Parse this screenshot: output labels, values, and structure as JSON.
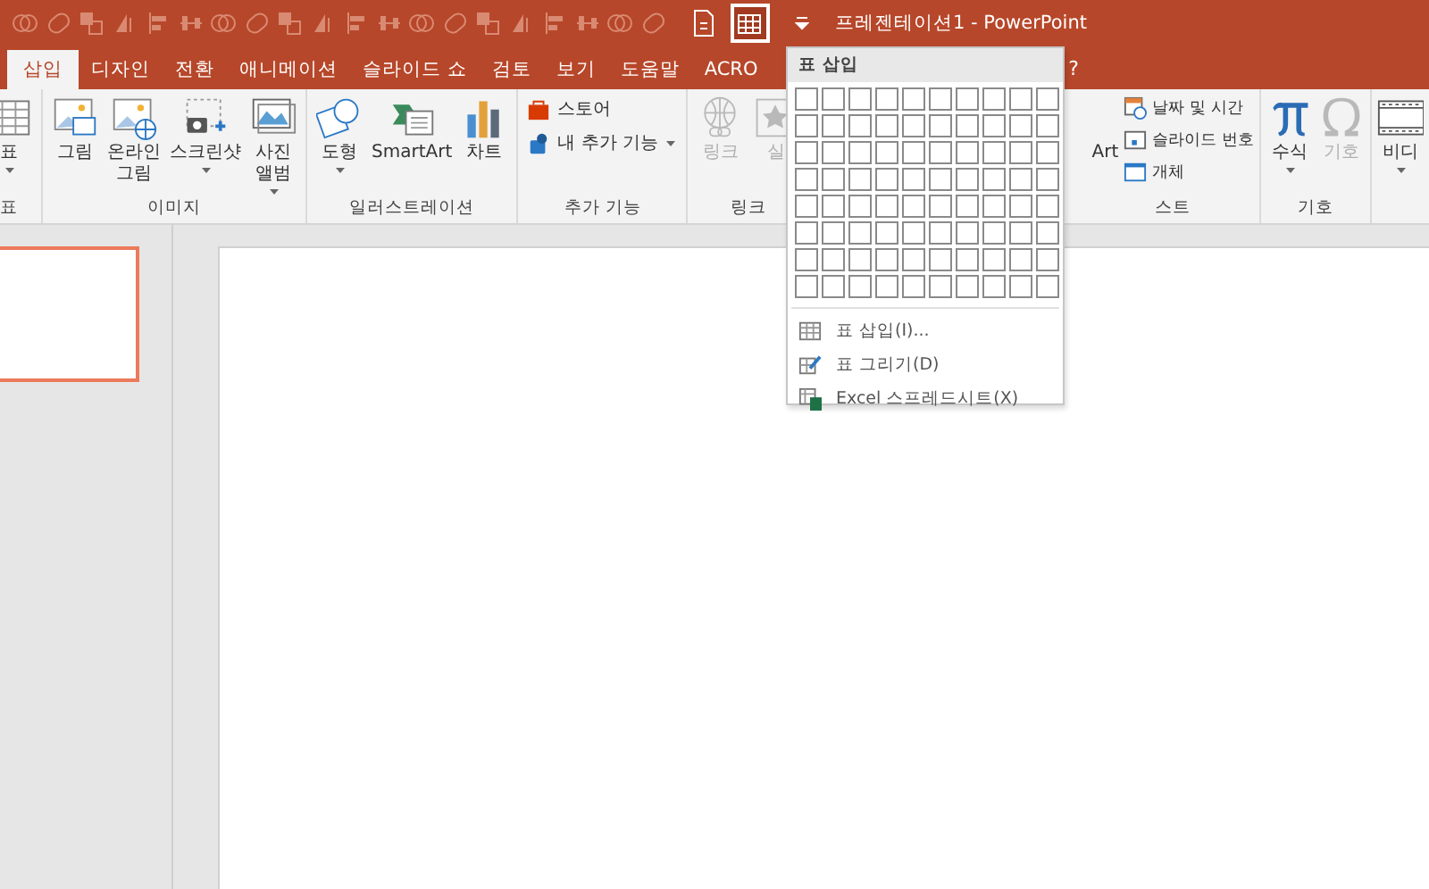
{
  "title_bar": {
    "table_button_selected": true,
    "title": "프레젠테이션1  -  PowerPoint"
  },
  "tabs": [
    {
      "label": "삽입",
      "selected": true
    },
    {
      "label": "디자인",
      "selected": false
    },
    {
      "label": "전환",
      "selected": false
    },
    {
      "label": "애니메이션",
      "selected": false
    },
    {
      "label": "슬라이드 쇼",
      "selected": false
    },
    {
      "label": "검토",
      "selected": false
    },
    {
      "label": "보기",
      "selected": false
    },
    {
      "label": "도움말",
      "selected": false
    },
    {
      "label": "ACRO",
      "selected": false
    }
  ],
  "tell_me": "?",
  "ribbon": [
    {
      "label": "표",
      "items": [
        {
          "kind": "large",
          "label": "표",
          "caret": true,
          "disabled": false
        }
      ]
    },
    {
      "label": "이미지",
      "items": [
        {
          "kind": "large",
          "label": "그림",
          "caret": false,
          "disabled": false
        },
        {
          "kind": "large",
          "label": "온라인 그림",
          "caret": false,
          "disabled": false
        },
        {
          "kind": "large",
          "label": "스크린샷",
          "caret": true,
          "disabled": false
        },
        {
          "kind": "large",
          "label": "사진 앨범",
          "caret": true,
          "disabled": false
        }
      ]
    },
    {
      "label": "일러스트레이션",
      "items": [
        {
          "kind": "large",
          "label": "도형",
          "caret": true,
          "disabled": false
        },
        {
          "kind": "large",
          "label": "SmartArt",
          "caret": false,
          "disabled": false
        },
        {
          "kind": "large",
          "label": "차트",
          "caret": false,
          "disabled": false
        }
      ]
    },
    {
      "label": "추가 기능",
      "items": [
        {
          "kind": "small",
          "label": "스토어",
          "caret": false,
          "disabled": false
        },
        {
          "kind": "small",
          "label": "내 추가 기능",
          "caret": true,
          "disabled": false
        }
      ]
    },
    {
      "label": "링크",
      "items": [
        {
          "kind": "large",
          "label": "링크",
          "caret": false,
          "disabled": true
        },
        {
          "kind": "large",
          "label": "실",
          "caret": false,
          "disabled": true
        }
      ]
    },
    {
      "label": "스트",
      "items": [
        {
          "kind": "large",
          "label": "Art",
          "caret": false,
          "disabled": false
        },
        {
          "kind": "small",
          "label": "날짜 및 시간",
          "caret": false,
          "disabled": false
        },
        {
          "kind": "small",
          "label": "슬라이드 번호",
          "caret": false,
          "disabled": false
        },
        {
          "kind": "small",
          "label": "개체",
          "caret": false,
          "disabled": false
        }
      ]
    },
    {
      "label": "기호",
      "items": [
        {
          "kind": "large",
          "label": "수식",
          "caret": true,
          "disabled": false
        },
        {
          "kind": "large",
          "label": "기호",
          "caret": false,
          "disabled": true
        }
      ]
    },
    {
      "items": [
        {
          "kind": "large",
          "label": "비디",
          "caret": true,
          "disabled": false
        }
      ]
    }
  ],
  "table_menu": {
    "header": "표 삽입",
    "items": [
      {
        "label": "표 삽입(I)..."
      },
      {
        "label": "표 그리기(D)"
      },
      {
        "label": "Excel 스프레드시트(X)"
      }
    ]
  },
  "thumbnail": {
    "selected": true
  }
}
